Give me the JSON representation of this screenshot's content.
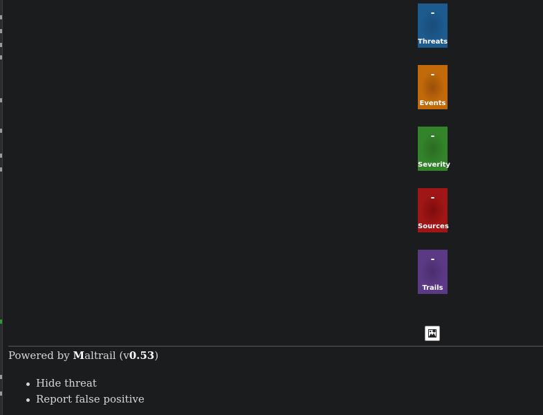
{
  "stats": [
    {
      "label": "Threats",
      "value": "-",
      "color": "#1d5a8e",
      "center": "#194c7a"
    },
    {
      "label": "Events",
      "value": "-",
      "color": "#c26a0a",
      "center": "#9c4f0a"
    },
    {
      "label": "Severity",
      "value": "-",
      "color": "#33832a",
      "center": "#2b6b22"
    },
    {
      "label": "Sources",
      "value": "-",
      "color": "#a01616",
      "center": "#7e0c0c"
    },
    {
      "label": "Trails",
      "value": "-",
      "color": "#5b3a85",
      "center": "#4a2d6e"
    }
  ],
  "footer": {
    "prefix": "Powered by ",
    "brand_initial": "M",
    "brand_rest": "altrail",
    "version_open": " (v",
    "version": "0.53",
    "version_close": ")"
  },
  "context_menu": {
    "items": [
      "Hide threat",
      "Report false positive"
    ]
  },
  "export_icon": "image-download-icon"
}
